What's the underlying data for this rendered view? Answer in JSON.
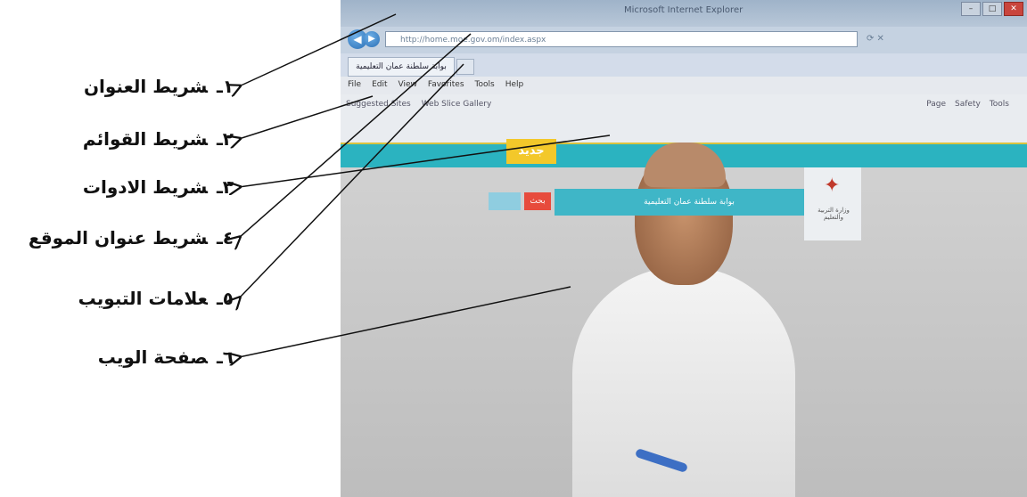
{
  "legend": [
    {
      "num": "١ـ",
      "label": "شريط العنوان"
    },
    {
      "num": "٢ـ",
      "label": "شريط القوائم"
    },
    {
      "num": "٣ـ",
      "label": "شريط الادوات"
    },
    {
      "num": "٤ـ",
      "label": "شريط عنوان الموقع"
    },
    {
      "num": "٥ـ",
      "label": "علامات التبويب"
    },
    {
      "num": "٦ـ",
      "label": "صفحة الويب"
    }
  ],
  "browser": {
    "title": "Microsoft Internet Explorer",
    "address": "http://home.moe.gov.om/index.aspx",
    "tab_label": "بوابة سلطنة عمان التعليمية",
    "menu": [
      "File",
      "Edit",
      "View",
      "Favorites",
      "Tools",
      "Help"
    ],
    "favorites": [
      "Suggested Sites",
      "Web Slice Gallery"
    ],
    "commands": [
      "Page",
      "Safety",
      "Tools"
    ]
  },
  "site": {
    "new_label": "جديد",
    "banner_text": "بوابة سلطنة عمان التعليمية",
    "search_label": "بحث",
    "logo_text": "وزارة التربية والتعليم"
  },
  "colors": {
    "teal": "#2bb3c0",
    "yellow": "#f3c82a",
    "red": "#e74b3c"
  }
}
